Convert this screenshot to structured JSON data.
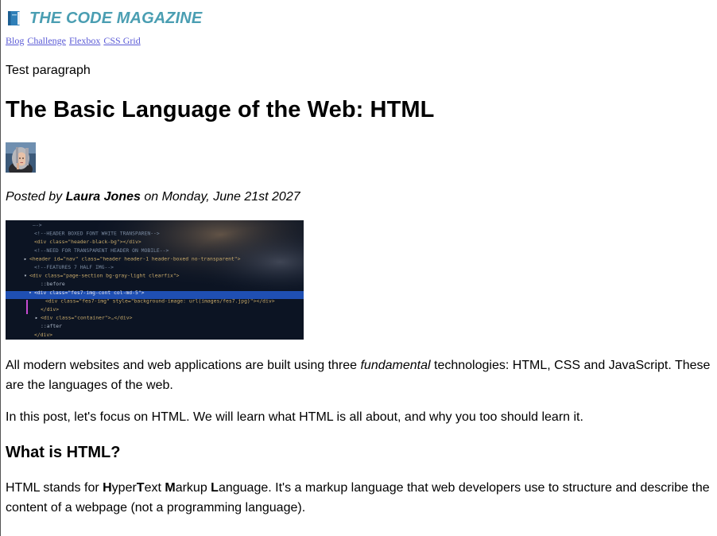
{
  "site": {
    "title": "THE CODE MAGAZINE",
    "icon": "book-icon",
    "title_color": "#4a9eb2"
  },
  "nav": {
    "links": [
      "Blog",
      "Challenge",
      "Flexbox",
      "CSS Grid"
    ],
    "link_color": "#5a5ad6"
  },
  "test_paragraph": "Test paragraph",
  "post": {
    "title": "The Basic Language of the Web: HTML",
    "byline": {
      "prefix": "Posted by ",
      "author": "Laura Jones",
      "suffix": " on Monday, June 21st 2027"
    },
    "code_image_lines": [
      "—-> ",
      "<!--HEADER BOXED FONT WHITE TRANSPAREN-->",
      "<div class=\"header-black-bg\"></div>",
      "<!--NEED FOR TRANSPARENT HEADER ON MOBILE-->",
      "<header id=\"nav\" class=\"header header-1 header-boxed no-transparent\">",
      "<!--FEATURES 7 HALF IMG-->",
      "<div class=\"page-section bg-gray-light clearfix\">",
      "::before",
      "<div class=\"fes7-img-cont col-md-5\">",
      "<div class=\"fes7-img\" style=\"background-image: url(images/fes7.jpg)\"></div>",
      "</div>",
      "<div class=\"container\">…</div>",
      "::after",
      "</div>"
    ],
    "intro": {
      "before": "All modern websites and web applications are built using three ",
      "emphasis": "fundamental",
      "after": " technologies: HTML, CSS and JavaScript. These are the languages of the web."
    },
    "focus": "In this post, let's focus on HTML. We will learn what HTML is all about, and why you too should learn it.",
    "section_title": "What is HTML?",
    "definition": {
      "p1": "HTML stands for ",
      "h": "H",
      "yper": "yper",
      "t": "T",
      "ext": "ext ",
      "m": "M",
      "arkup": "arkup ",
      "l": "L",
      "anguage": "anguage",
      "rest": ". It's a markup language that web developers use to structure and describe the content of a webpage (not a programming language)."
    }
  }
}
